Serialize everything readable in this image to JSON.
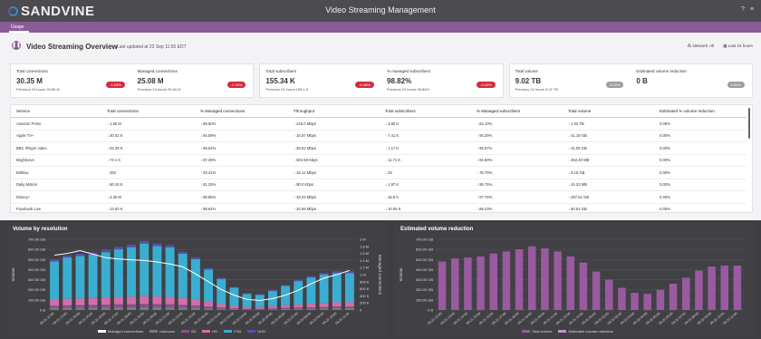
{
  "app": {
    "brand": "SANDVINE",
    "title": "Video Streaming Management"
  },
  "icons": {
    "help": "help-icon",
    "menu": "menu-icon"
  },
  "tab": {
    "label": "Usage"
  },
  "overview": {
    "title": "Video Streaming Overview",
    "updated": "Last updated at 22 Sep 11:50 EDT",
    "filter": "Network: All",
    "range": "Last 24 hours"
  },
  "kpis": [
    [
      {
        "label": "Total connections",
        "value": "30.35 M",
        "prev": "Previous 24 hours 30.85 M",
        "badge": "-1.53%",
        "badge_color": "red"
      },
      {
        "label": "Managed connections",
        "value": "25.08 M",
        "prev": "Previous 24 hours 25.84 M",
        "badge": "-2.15%",
        "badge_color": "red"
      }
    ],
    [
      {
        "label": "Total subscribers",
        "value": "155.34 K",
        "prev": "Previous 24 hours 158.1 K",
        "badge": "-0.48%",
        "badge_color": "red"
      },
      {
        "label": "% managed subscribers",
        "value": "98.82%",
        "prev": "Previous 24 hours 98.84%",
        "badge": "-0.02%",
        "badge_color": "red"
      }
    ],
    [
      {
        "label": "Total volume",
        "value": "9.02 TB",
        "prev": "Previous 24 hours 9.02 TB",
        "badge": "0.00%",
        "badge_color": "grey"
      },
      {
        "label": "Estimated volume reduction",
        "value": "0 B",
        "prev": "",
        "badge": "0.00%",
        "badge_color": "grey"
      }
    ]
  ],
  "table": {
    "headers": [
      "Service",
      "Total connections",
      "% Managed connections",
      "Throughput",
      "Total subscribers",
      "% Managed subscribers",
      "Total volume",
      "Estimated % volume reduction"
    ],
    "rows": [
      {
        "service": "Amazon Prime",
        "cells": [
          [
            "dn",
            "1.50 M"
          ],
          [
            "dn",
            "89.50%"
          ],
          [
            "up",
            "215.0 Mbps"
          ],
          [
            "dn",
            "3.80 K"
          ],
          [
            "dn",
            "84.10%"
          ],
          [
            "up",
            "1.03 TB"
          ],
          [
            "",
            "0.00%"
          ]
        ]
      },
      {
        "service": "Apple TV+",
        "cells": [
          [
            "dn",
            "30.02 K"
          ],
          [
            "dn",
            "94.59%"
          ],
          [
            "up",
            "16.57 Mbps"
          ],
          [
            "up",
            "7.41 K"
          ],
          [
            "up",
            "94.29%"
          ],
          [
            "dn",
            "41.19 GB"
          ],
          [
            "",
            "0.00%"
          ]
        ]
      },
      {
        "service": "BBC iPlayer video",
        "cells": [
          [
            "dn",
            "62.39 K"
          ],
          [
            "dn",
            "99.63%"
          ],
          [
            "dn",
            "28.53 Mbps"
          ],
          [
            "dn",
            "1.17 K"
          ],
          [
            "dn",
            "95.57%"
          ],
          [
            "dn",
            "31.05 GB"
          ],
          [
            "",
            "0.00%"
          ]
        ]
      },
      {
        "service": "Brightcove",
        "cells": [
          [
            "dn",
            "74.1 K"
          ],
          [
            "dn",
            "87.39%"
          ],
          [
            "dn",
            "502.59 Kbps"
          ],
          [
            "dn",
            "11.71 K"
          ],
          [
            "dn",
            "84.50%"
          ],
          [
            "dn",
            "452.40 MB"
          ],
          [
            "",
            "0.00%"
          ]
        ]
      },
      {
        "service": "BritBox",
        "cells": [
          [
            "dn",
            "282"
          ],
          [
            "up",
            "93.41%"
          ],
          [
            "dn",
            "16.12 Mbps"
          ],
          [
            "dn",
            "33"
          ],
          [
            "dn",
            "78.79%"
          ],
          [
            "dn",
            "8.15 GB"
          ],
          [
            "",
            "0.00%"
          ]
        ]
      },
      {
        "service": "Daily Motion",
        "cells": [
          [
            "dn",
            "60.15 K"
          ],
          [
            "up",
            "81.25%"
          ],
          [
            "dn",
            "90.0 Kbps"
          ],
          [
            "dn",
            "1.97 K"
          ],
          [
            "dn",
            "95.75%"
          ],
          [
            "dn",
            "44.23 MB"
          ],
          [
            "",
            "0.00%"
          ]
        ]
      },
      {
        "service": "Disney+",
        "cells": [
          [
            "dn",
            "3.20 M"
          ],
          [
            "dn",
            "99.85%"
          ],
          [
            "up",
            "33.03 Mbps"
          ],
          [
            "dn",
            "16.8 K"
          ],
          [
            "up",
            "97.75%"
          ],
          [
            "up",
            "287.51 GB"
          ],
          [
            "",
            "0.00%"
          ]
        ]
      },
      {
        "service": "Facebook Live",
        "cells": [
          [
            "dn",
            "13.00 K"
          ],
          [
            "up",
            "98.62%"
          ],
          [
            "dn",
            "20.06 Mbps"
          ],
          [
            "dn",
            "10.05 K"
          ],
          [
            "dn",
            "89.23%"
          ],
          [
            "dn",
            "50.52 GB"
          ],
          [
            "",
            "0.00%"
          ]
        ]
      }
    ]
  },
  "resolution_chart": {
    "title": "Volume by resolution",
    "ylabel": "Volume",
    "y2label": "Managed connections",
    "yticks": [
      "0 B",
      "100.00 GB",
      "200.00 GB",
      "300.00 GB",
      "400.00 GB",
      "500.00 GB",
      "600.00 GB",
      "700.00 GB"
    ],
    "y2ticks": [
      "0",
      "200 K",
      "400 K",
      "600 K",
      "800 K",
      "1 M",
      "1.2 M",
      "1.4 M",
      "1.6 M",
      "1.8 M",
      "2 M"
    ],
    "legend": [
      "Managed connections",
      "Unknown",
      "SD",
      "HD",
      "FHD",
      "UHD"
    ]
  },
  "reduction_chart": {
    "title": "Estimated volume reduction",
    "ylabel": "Volume",
    "yticks": [
      "0 B",
      "100.00 GB",
      "200.00 GB",
      "300.00 GB",
      "400.00 GB",
      "500.00 GB",
      "600.00 GB",
      "700.00 GB"
    ],
    "legend": [
      "Total volume",
      "Estimated volume reduction"
    ]
  },
  "chart_data": [
    {
      "type": "bar",
      "title": "Volume by resolution",
      "ylabel": "Volume",
      "ylim": [
        0,
        700
      ],
      "y_unit": "GB",
      "categories": [
        "09-21 12:00",
        "09-21 13:00",
        "09-21 14:00",
        "09-21 15:00",
        "09-21 16:00",
        "09-21 17:00",
        "09-21 18:00",
        "09-21 19:00",
        "09-21 20:00",
        "09-21 21:00",
        "09-21 22:00",
        "09-21 23:00",
        "09-22 00:00",
        "09-22 01:00",
        "09-22 02:00",
        "09-22 03:00",
        "09-22 04:00",
        "09-22 05:00",
        "09-22 06:00",
        "09-22 07:00",
        "09-22 08:00",
        "09-22 09:00",
        "09-22 10:00",
        "09-22 11:00"
      ],
      "series": [
        {
          "name": "Unknown",
          "values": [
            22,
            24,
            24,
            26,
            26,
            28,
            28,
            30,
            30,
            28,
            26,
            22,
            16,
            12,
            8,
            6,
            6,
            8,
            10,
            12,
            14,
            16,
            18,
            18
          ]
        },
        {
          "name": "SD",
          "values": [
            20,
            22,
            24,
            24,
            26,
            28,
            28,
            30,
            28,
            28,
            24,
            22,
            18,
            12,
            8,
            6,
            6,
            8,
            10,
            12,
            12,
            14,
            16,
            16
          ]
        },
        {
          "name": "HD",
          "values": [
            60,
            64,
            66,
            68,
            70,
            74,
            76,
            78,
            76,
            74,
            68,
            60,
            46,
            34,
            24,
            18,
            18,
            22,
            28,
            32,
            36,
            40,
            42,
            42
          ]
        },
        {
          "name": "FHD",
          "values": [
            380,
            410,
            420,
            430,
            450,
            470,
            490,
            520,
            500,
            490,
            440,
            400,
            320,
            250,
            180,
            130,
            120,
            150,
            190,
            230,
            260,
            280,
            290,
            290
          ]
        },
        {
          "name": "UHD",
          "values": [
            20,
            20,
            22,
            22,
            24,
            24,
            26,
            26,
            24,
            22,
            20,
            18,
            14,
            10,
            8,
            6,
            6,
            8,
            10,
            12,
            14,
            16,
            18,
            18
          ]
        }
      ],
      "y2lim": [
        0,
        2
      ],
      "y2_unit": "M",
      "line": {
        "name": "Managed connections",
        "values": [
          1.55,
          1.6,
          1.68,
          1.58,
          1.48,
          1.44,
          1.42,
          1.4,
          1.36,
          1.3,
          1.22,
          1.02,
          0.8,
          0.58,
          0.42,
          0.3,
          0.27,
          0.32,
          0.42,
          0.56,
          0.74,
          0.9,
          1.0,
          1.12
        ]
      }
    },
    {
      "type": "bar",
      "title": "Estimated volume reduction",
      "ylabel": "Volume",
      "ylim": [
        0,
        700
      ],
      "y_unit": "GB",
      "categories": [
        "09-21 12:00",
        "09-21 13:00",
        "09-21 14:00",
        "09-21 15:00",
        "09-21 16:00",
        "09-21 17:00",
        "09-21 18:00",
        "09-21 19:00",
        "09-21 20:00",
        "09-21 21:00",
        "09-21 22:00",
        "09-21 23:00",
        "09-22 00:00",
        "09-22 01:00",
        "09-22 02:00",
        "09-22 03:00",
        "09-22 04:00",
        "09-22 05:00",
        "09-22 06:00",
        "09-22 07:00",
        "09-22 08:00",
        "09-22 09:00",
        "09-22 10:00",
        "09-22 11:00"
      ],
      "series": [
        {
          "name": "Total volume",
          "values": [
            480,
            510,
            520,
            530,
            560,
            580,
            600,
            630,
            610,
            580,
            530,
            470,
            380,
            300,
            220,
            170,
            160,
            200,
            260,
            320,
            390,
            430,
            440,
            440
          ]
        },
        {
          "name": "Estimated volume reduction",
          "values": [
            0,
            0,
            0,
            0,
            0,
            0,
            0,
            0,
            0,
            0,
            0,
            0,
            0,
            0,
            0,
            0,
            0,
            0,
            0,
            0,
            0,
            0,
            0,
            0
          ]
        }
      ]
    }
  ],
  "colors": {
    "brand_purple": "#8a5c97",
    "unknown": "#7a7a7e",
    "sd": "#8a4f8f",
    "hd": "#d36ea8",
    "fhd": "#3aaed0",
    "uhd": "#5a4fa8",
    "line": "#ffffff",
    "total_volume": "#9a5a9f",
    "reduction": "#c98fc9"
  }
}
